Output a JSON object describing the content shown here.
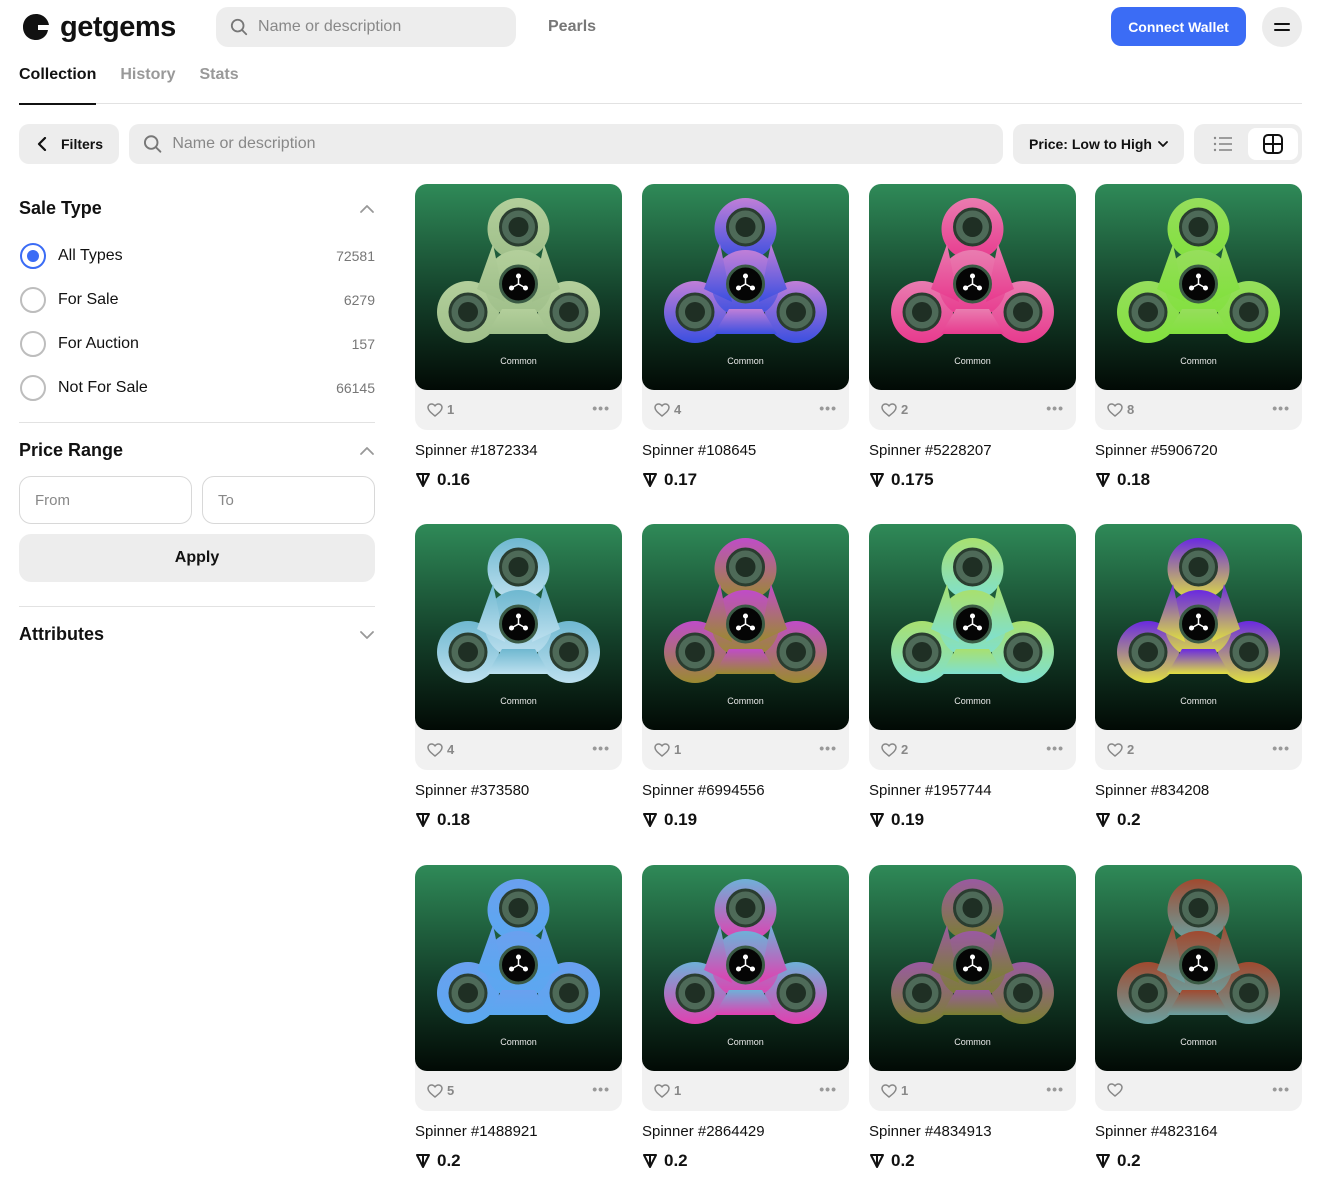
{
  "header": {
    "logo_text": "getgems",
    "search_placeholder": "Name or description",
    "nav_link": "Pearls",
    "connect_label": "Connect Wallet"
  },
  "tabs": [
    {
      "label": "Collection",
      "active": true
    },
    {
      "label": "History",
      "active": false
    },
    {
      "label": "Stats",
      "active": false
    }
  ],
  "toolbar": {
    "filters_label": "Filters",
    "search_placeholder": "Name or description",
    "sort_label": "Price: Low to High"
  },
  "sidebar": {
    "sale_type": {
      "title": "Sale Type",
      "options": [
        {
          "label": "All Types",
          "count": "72581",
          "checked": true
        },
        {
          "label": "For Sale",
          "count": "6279",
          "checked": false
        },
        {
          "label": "For Auction",
          "count": "157",
          "checked": false
        },
        {
          "label": "Not For Sale",
          "count": "66145",
          "checked": false
        }
      ]
    },
    "price_range": {
      "title": "Price Range",
      "from_placeholder": "From",
      "to_placeholder": "To",
      "apply_label": "Apply"
    },
    "attributes": {
      "title": "Attributes"
    }
  },
  "colors": {
    "accent": "#3b6cf5"
  },
  "items": [
    {
      "name": "Spinner #1872334",
      "price": "0.16",
      "likes": "1",
      "rarity": "Common",
      "c1": "#b3cf9b",
      "c2": "#9fbf8a"
    },
    {
      "name": "Spinner #108645",
      "price": "0.17",
      "likes": "4",
      "rarity": "Common",
      "c1": "#c07fd8",
      "c2": "#3b4fe0"
    },
    {
      "name": "Spinner #5228207",
      "price": "0.175",
      "likes": "2",
      "rarity": "Common",
      "c1": "#e97cb0",
      "c2": "#e83a8e"
    },
    {
      "name": "Spinner #5906720",
      "price": "0.18",
      "likes": "8",
      "rarity": "Common",
      "c1": "#96de5c",
      "c2": "#82e03e"
    },
    {
      "name": "Spinner #373580",
      "price": "0.18",
      "likes": "4",
      "rarity": "Common",
      "c1": "#6fb8d0",
      "c2": "#bde0ef"
    },
    {
      "name": "Spinner #6994556",
      "price": "0.19",
      "likes": "1",
      "rarity": "Common",
      "c1": "#c04cc8",
      "c2": "#9a8a30"
    },
    {
      "name": "Spinner #1957744",
      "price": "0.19",
      "likes": "2",
      "rarity": "Common",
      "c1": "#a8e070",
      "c2": "#7fe0d0"
    },
    {
      "name": "Spinner #834208",
      "price": "0.2",
      "likes": "2",
      "rarity": "Common",
      "c1": "#6a2ae0",
      "c2": "#e0e040"
    },
    {
      "name": "Spinner #1488921",
      "price": "0.2",
      "likes": "5",
      "rarity": "Common",
      "c1": "#6aa0ef",
      "c2": "#5aa8f0"
    },
    {
      "name": "Spinner #2864429",
      "price": "0.2",
      "likes": "1",
      "rarity": "Common",
      "c1": "#6fb0d8",
      "c2": "#e040b0"
    },
    {
      "name": "Spinner #4834913",
      "price": "0.2",
      "likes": "1",
      "rarity": "Common",
      "c1": "#9a5aa0",
      "c2": "#7a8030"
    },
    {
      "name": "Spinner #4823164",
      "price": "0.2",
      "likes": "",
      "rarity": "Common",
      "c1": "#a04a30",
      "c2": "#6aa0a0"
    }
  ]
}
